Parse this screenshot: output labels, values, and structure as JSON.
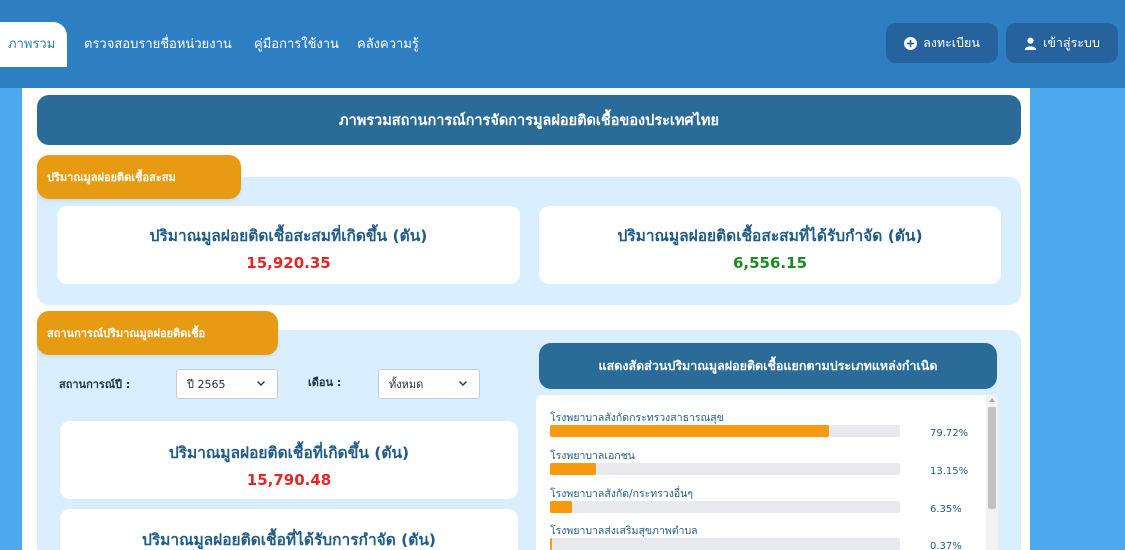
{
  "nav": {
    "tabs": [
      {
        "label": "ภาพรวม"
      },
      {
        "label": "ตรวจสอบรายชื่อหน่วยงาน"
      },
      {
        "label": "คู่มือการใช้งาน"
      },
      {
        "label": "คลังความรู้"
      }
    ],
    "register_label": "ลงทะเบียน",
    "login_label": "เข้าสู่ระบบ"
  },
  "page": {
    "title": "ภาพรวมสถานการณ์การจัดการมูลฝอยติดเชื้อของประเทศไทย"
  },
  "accumulated": {
    "section_label": "ปริมาณมูลฝอยติดเชื้อสะสม",
    "generated_title": "ปริมาณมูลฝอยติดเชื้อสะสมที่เกิดขึ้น (ตัน)",
    "generated_value": "15,920.35",
    "disposed_title": "ปริมาณมูลฝอยติดเชื้อสะสมที่ได้รับกำจัด (ตัน)",
    "disposed_value": "6,556.15"
  },
  "situation": {
    "section_label": "สถานการณ์ปริมาณมูลฝอยติดเชื้อ",
    "year_label": "สถานการณ์ปี :",
    "year_value": "ปี 2565",
    "month_label": "เดือน :",
    "month_value": "ทั้งหมด",
    "generated_title": "ปริมาณมูลฝอยติดเชื้อที่เกิดขึ้น (ตัน)",
    "generated_value": "15,790.48",
    "disposed_title": "ปริมาณมูลฝอยติดเชื้อที่ได้รับการกำจัด (ตัน)"
  },
  "sources": {
    "title": "แสดงสัดส่วนปริมาณมูลฝอยติดเชื้อแยกตามประเภทแหล่งกำเนิด",
    "items": [
      {
        "name": "โรงพยาบาลสังกัดกระทรวงสาธารณสุข",
        "percent": 79.72,
        "percent_label": "79.72%"
      },
      {
        "name": "โรงพยาบาลเอกชน",
        "percent": 13.15,
        "percent_label": "13.15%"
      },
      {
        "name": "โรงพยาบาลสังกัด/กระทรวงอื่นๆ",
        "percent": 6.35,
        "percent_label": "6.35%"
      },
      {
        "name": "โรงพยาบาลส่งเสริมสุขภาพตำบล",
        "percent": 0.37,
        "percent_label": "0.37%"
      }
    ]
  },
  "colors": {
    "nav_bg": "#2e7fc2",
    "header_bg": "#2a6b98",
    "section_label": "#e79b13",
    "panel_bg": "#d9efff",
    "bar_fill": "#f79a10",
    "value_red": "#e32626",
    "value_green": "#1c8a24"
  },
  "icons": {
    "register": "plus-circle-icon",
    "login": "user-icon",
    "select_chevron": "chevron-down-icon"
  }
}
